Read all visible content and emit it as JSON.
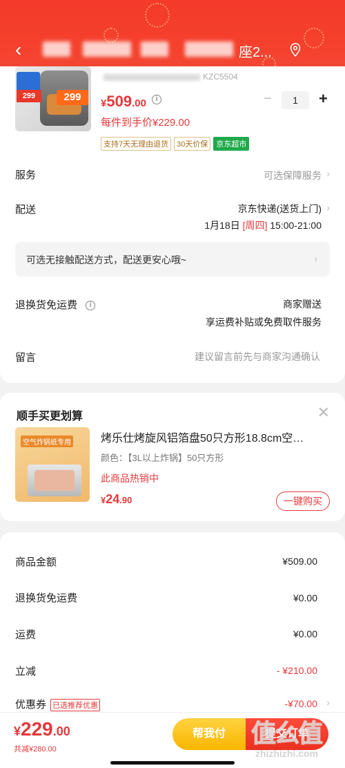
{
  "header": {
    "title": "座2...",
    "back_icon": "chevron-left-icon",
    "location_icon": "location-pin-icon"
  },
  "product": {
    "spec_suffix": "KZC5504",
    "thumb_badges": [
      "299",
      "299"
    ],
    "price_symbol": "¥",
    "price_int": "509",
    "price_dec": ".00",
    "each_label": "每件到手价¥229.00",
    "quantity": "1",
    "tags": [
      "支持7天无理由退货",
      "30天价保",
      "京东超市"
    ]
  },
  "rows": {
    "service_label": "服务",
    "service_value": "可选保障服务",
    "delivery_label": "配送",
    "delivery_line1": "京东快递(送货上门)",
    "delivery_date": "1月18日",
    "delivery_weekday": "[周四]",
    "delivery_time": "15:00-21:00",
    "tip": "可选无接触配送方式，配送更安心哦~",
    "return_label": "退换货免运费",
    "return_value1": "商家赠送",
    "return_value2": "享运费补贴或免费取件服务",
    "message_label": "留言",
    "message_placeholder": "建议留言前先与商家沟通确认"
  },
  "recommend": {
    "heading": "顺手买更划算",
    "image_label": "空气炸锅纸专用",
    "title": "烤乐仕烤旋风铝箔盘50只方形18.8cm空…",
    "color": "颜色：【3L以上炸锅】50只方形",
    "hot": "此商品热销中",
    "price_symbol": "¥",
    "price_int": "24",
    "price_dec": ".90",
    "buy_label": "一键购买"
  },
  "summary": {
    "items": [
      {
        "label": "商品金额",
        "value": "¥509.00"
      },
      {
        "label": "退换货免运费",
        "value": "¥0.00"
      },
      {
        "label": "运费",
        "value": "¥0.00"
      },
      {
        "label": "立减",
        "value": "- ¥210.00"
      },
      {
        "label": "优惠券",
        "value": "-¥70.00"
      }
    ],
    "coupon_tag": "已选推荐优惠"
  },
  "bottom": {
    "total_symbol": "¥",
    "total_int": "229",
    "total_dec": ".00",
    "saved": "共减¥280.00",
    "help_label": "帮我付",
    "pay_label": "提交订单"
  },
  "watermark": {
    "big": "值么值",
    "small": "zhizhizhi.com"
  },
  "colors": {
    "accent": "#e4393c",
    "header": "#f43a2a",
    "help": "#f8b600",
    "green_tag": "#1fa94a"
  }
}
